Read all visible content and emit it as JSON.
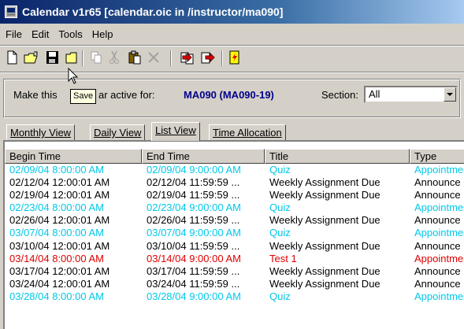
{
  "window": {
    "title": "Calendar v1r65 [calendar.oic in /instructor/ma090]"
  },
  "menu": {
    "items": [
      "File",
      "Edit",
      "Tools",
      "Help"
    ]
  },
  "tooltip": {
    "text": "Save"
  },
  "active_panel": {
    "label_before": "Make this",
    "label_after": "ar active for:",
    "course": "MA090 (MA090-19)",
    "section_label": "Section:",
    "section_value": "All"
  },
  "tabs": [
    "Monthly View",
    "Daily View",
    "List View",
    "Time Allocation"
  ],
  "active_tab": "List View",
  "columns": [
    "Begin Time",
    "End Time",
    "Title",
    "Type"
  ],
  "colors": {
    "quiz": "#00c8e8",
    "announcement": "#000000",
    "test": "#e00000"
  },
  "rows": [
    {
      "begin": "02/09/04 8:00:00 AM",
      "end": "02/09/04 9:00:00 AM",
      "title": "Quiz",
      "type": "Appointme",
      "kind": "quiz"
    },
    {
      "begin": "02/12/04 12:00:01 AM",
      "end": "02/12/04 11:59:59 ...",
      "title": "Weekly Assignment Due",
      "type": "Announce",
      "kind": "announcement"
    },
    {
      "begin": "02/19/04 12:00:01 AM",
      "end": "02/19/04 11:59:59 ...",
      "title": "Weekly Assignment Due",
      "type": "Announce",
      "kind": "announcement"
    },
    {
      "begin": "02/23/04 8:00:00 AM",
      "end": "02/23/04 9:00:00 AM",
      "title": "Quiz",
      "type": "Appointme",
      "kind": "quiz"
    },
    {
      "begin": "02/26/04 12:00:01 AM",
      "end": "02/26/04 11:59:59 ...",
      "title": "Weekly Assignment Due",
      "type": "Announce",
      "kind": "announcement"
    },
    {
      "begin": "03/07/04 8:00:00 AM",
      "end": "03/07/04 9:00:00 AM",
      "title": "Quiz",
      "type": "Appointme",
      "kind": "quiz"
    },
    {
      "begin": "03/10/04 12:00:01 AM",
      "end": "03/10/04 11:59:59 ...",
      "title": "Weekly Assignment Due",
      "type": "Announce",
      "kind": "announcement"
    },
    {
      "begin": "03/14/04 8:00:00 AM",
      "end": "03/14/04 9:00:00 AM",
      "title": "Test 1",
      "type": "Appointme",
      "kind": "test"
    },
    {
      "begin": "03/17/04 12:00:01 AM",
      "end": "03/17/04 11:59:59 ...",
      "title": "Weekly Assignment Due",
      "type": "Announce",
      "kind": "announcement"
    },
    {
      "begin": "03/24/04 12:00:01 AM",
      "end": "03/24/04 11:59:59 ...",
      "title": "Weekly Assignment Due",
      "type": "Announce",
      "kind": "announcement"
    },
    {
      "begin": "03/28/04 8:00:00 AM",
      "end": "03/28/04 9:00:00 AM",
      "title": "Quiz",
      "type": "Appointme",
      "kind": "quiz"
    }
  ]
}
